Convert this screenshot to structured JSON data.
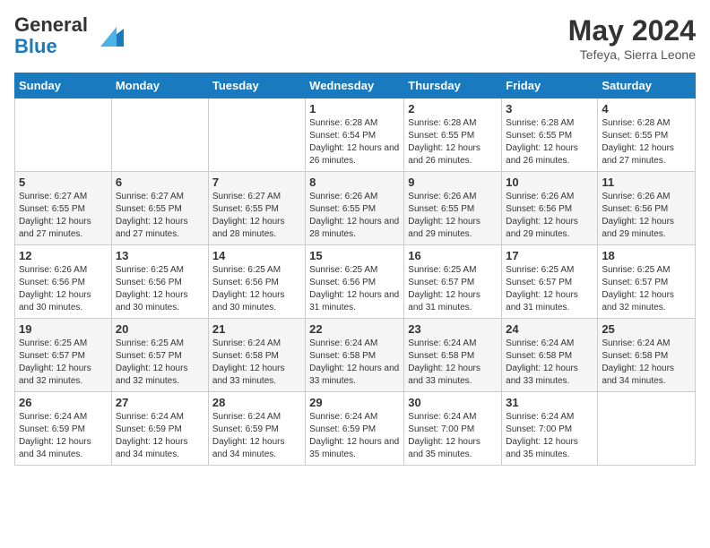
{
  "header": {
    "logo_general": "General",
    "logo_blue": "Blue",
    "month": "May 2024",
    "location": "Tefeya, Sierra Leone"
  },
  "weekdays": [
    "Sunday",
    "Monday",
    "Tuesday",
    "Wednesday",
    "Thursday",
    "Friday",
    "Saturday"
  ],
  "weeks": [
    [
      {
        "day": "",
        "info": ""
      },
      {
        "day": "",
        "info": ""
      },
      {
        "day": "",
        "info": ""
      },
      {
        "day": "1",
        "info": "Sunrise: 6:28 AM\nSunset: 6:54 PM\nDaylight: 12 hours and 26 minutes."
      },
      {
        "day": "2",
        "info": "Sunrise: 6:28 AM\nSunset: 6:55 PM\nDaylight: 12 hours and 26 minutes."
      },
      {
        "day": "3",
        "info": "Sunrise: 6:28 AM\nSunset: 6:55 PM\nDaylight: 12 hours and 26 minutes."
      },
      {
        "day": "4",
        "info": "Sunrise: 6:28 AM\nSunset: 6:55 PM\nDaylight: 12 hours and 27 minutes."
      }
    ],
    [
      {
        "day": "5",
        "info": "Sunrise: 6:27 AM\nSunset: 6:55 PM\nDaylight: 12 hours and 27 minutes."
      },
      {
        "day": "6",
        "info": "Sunrise: 6:27 AM\nSunset: 6:55 PM\nDaylight: 12 hours and 27 minutes."
      },
      {
        "day": "7",
        "info": "Sunrise: 6:27 AM\nSunset: 6:55 PM\nDaylight: 12 hours and 28 minutes."
      },
      {
        "day": "8",
        "info": "Sunrise: 6:26 AM\nSunset: 6:55 PM\nDaylight: 12 hours and 28 minutes."
      },
      {
        "day": "9",
        "info": "Sunrise: 6:26 AM\nSunset: 6:55 PM\nDaylight: 12 hours and 29 minutes."
      },
      {
        "day": "10",
        "info": "Sunrise: 6:26 AM\nSunset: 6:56 PM\nDaylight: 12 hours and 29 minutes."
      },
      {
        "day": "11",
        "info": "Sunrise: 6:26 AM\nSunset: 6:56 PM\nDaylight: 12 hours and 29 minutes."
      }
    ],
    [
      {
        "day": "12",
        "info": "Sunrise: 6:26 AM\nSunset: 6:56 PM\nDaylight: 12 hours and 30 minutes."
      },
      {
        "day": "13",
        "info": "Sunrise: 6:25 AM\nSunset: 6:56 PM\nDaylight: 12 hours and 30 minutes."
      },
      {
        "day": "14",
        "info": "Sunrise: 6:25 AM\nSunset: 6:56 PM\nDaylight: 12 hours and 30 minutes."
      },
      {
        "day": "15",
        "info": "Sunrise: 6:25 AM\nSunset: 6:56 PM\nDaylight: 12 hours and 31 minutes."
      },
      {
        "day": "16",
        "info": "Sunrise: 6:25 AM\nSunset: 6:57 PM\nDaylight: 12 hours and 31 minutes."
      },
      {
        "day": "17",
        "info": "Sunrise: 6:25 AM\nSunset: 6:57 PM\nDaylight: 12 hours and 31 minutes."
      },
      {
        "day": "18",
        "info": "Sunrise: 6:25 AM\nSunset: 6:57 PM\nDaylight: 12 hours and 32 minutes."
      }
    ],
    [
      {
        "day": "19",
        "info": "Sunrise: 6:25 AM\nSunset: 6:57 PM\nDaylight: 12 hours and 32 minutes."
      },
      {
        "day": "20",
        "info": "Sunrise: 6:25 AM\nSunset: 6:57 PM\nDaylight: 12 hours and 32 minutes."
      },
      {
        "day": "21",
        "info": "Sunrise: 6:24 AM\nSunset: 6:58 PM\nDaylight: 12 hours and 33 minutes."
      },
      {
        "day": "22",
        "info": "Sunrise: 6:24 AM\nSunset: 6:58 PM\nDaylight: 12 hours and 33 minutes."
      },
      {
        "day": "23",
        "info": "Sunrise: 6:24 AM\nSunset: 6:58 PM\nDaylight: 12 hours and 33 minutes."
      },
      {
        "day": "24",
        "info": "Sunrise: 6:24 AM\nSunset: 6:58 PM\nDaylight: 12 hours and 33 minutes."
      },
      {
        "day": "25",
        "info": "Sunrise: 6:24 AM\nSunset: 6:58 PM\nDaylight: 12 hours and 34 minutes."
      }
    ],
    [
      {
        "day": "26",
        "info": "Sunrise: 6:24 AM\nSunset: 6:59 PM\nDaylight: 12 hours and 34 minutes."
      },
      {
        "day": "27",
        "info": "Sunrise: 6:24 AM\nSunset: 6:59 PM\nDaylight: 12 hours and 34 minutes."
      },
      {
        "day": "28",
        "info": "Sunrise: 6:24 AM\nSunset: 6:59 PM\nDaylight: 12 hours and 34 minutes."
      },
      {
        "day": "29",
        "info": "Sunrise: 6:24 AM\nSunset: 6:59 PM\nDaylight: 12 hours and 35 minutes."
      },
      {
        "day": "30",
        "info": "Sunrise: 6:24 AM\nSunset: 7:00 PM\nDaylight: 12 hours and 35 minutes."
      },
      {
        "day": "31",
        "info": "Sunrise: 6:24 AM\nSunset: 7:00 PM\nDaylight: 12 hours and 35 minutes."
      },
      {
        "day": "",
        "info": ""
      }
    ]
  ]
}
